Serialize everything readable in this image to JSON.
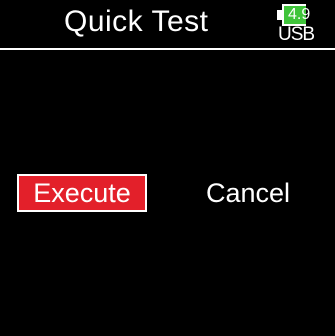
{
  "header": {
    "title": "Quick Test",
    "battery_level": "4.9",
    "power_source": "USB"
  },
  "dialog": {
    "execute_label": "Execute",
    "cancel_label": "Cancel"
  },
  "colors": {
    "background": "#000000",
    "accent_selected": "#e3202a",
    "battery_green": "#3fc43a",
    "text": "#ffffff"
  },
  "icons": {
    "battery": "battery-icon"
  }
}
